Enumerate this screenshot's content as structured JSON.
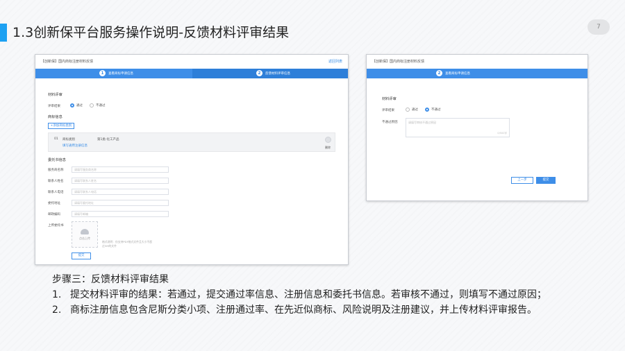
{
  "slide": {
    "title": "1.3创新保平台服务操作说明-反馈材料评审结果",
    "page_number": "7",
    "accent_color": "#1da1f2"
  },
  "screenshot_left": {
    "header_title": "【创新保】国内商标注册材料反馈",
    "header_link": "返回列表",
    "steps": [
      {
        "num": "1",
        "label": "查看商标申请信息"
      },
      {
        "num": "2",
        "label": "反馈材料评审信息"
      }
    ],
    "section_material_review": "材料评审",
    "review_result_label": "评审结果",
    "radio_pass": "通过",
    "radio_fail": "不通过",
    "selected_result": "通过",
    "section_trademark_info": "商标信息",
    "add_trademark_button": "+添加商标类别",
    "card": {
      "index": "01",
      "class_label": "商标类别",
      "class_value": "第1类-化工产品",
      "link": "填写通用注册信息",
      "delete_label": "删除"
    },
    "section_entrust": "委托书信息",
    "fields": [
      {
        "label": "服务商名称",
        "placeholder": "请填写服务商名称"
      },
      {
        "label": "联系人姓名",
        "placeholder": "请填写联系人姓名"
      },
      {
        "label": "联系人电话",
        "placeholder": "请填写联系人电话"
      },
      {
        "label": "委托地址",
        "placeholder": "请填写委托地址"
      },
      {
        "label": "邮政编码",
        "placeholder": "请填写邮编"
      }
    ],
    "upload_label": "上传委托书",
    "upload_button": "点击上传",
    "upload_hint_1": "格式说明：仅支持PDF格式文件且大小不超",
    "upload_hint_2": "过5M的文件",
    "submit_button": "提交"
  },
  "screenshot_right": {
    "header_title": "【创新保】国内商标注册材料反馈",
    "step": {
      "num": "2",
      "label": "查看商标申请信息"
    },
    "section_material_review": "材料评审",
    "review_result_label": "评审结果",
    "radio_pass": "通过",
    "radio_fail": "不通过",
    "selected_result": "不通过",
    "reason_label": "不通过原因",
    "reason_placeholder": "请填写审核不通过原因",
    "char_count": "0/500字",
    "prev_button": "上一步",
    "submit_button": "提交"
  },
  "caption": {
    "step_title": "步骤三：反馈材料评审结果",
    "items": [
      {
        "num": "1.",
        "text": "提交材料评审的结果：若通过，提交通过率信息、注册信息和委托书信息。若审核不通过，则填写不通过原因；"
      },
      {
        "num": "2.",
        "text": "商标注册信息包含尼斯分类小项、注册通过率、在先近似商标、风险说明及注册建议，并上传材料评审报告。"
      }
    ]
  }
}
